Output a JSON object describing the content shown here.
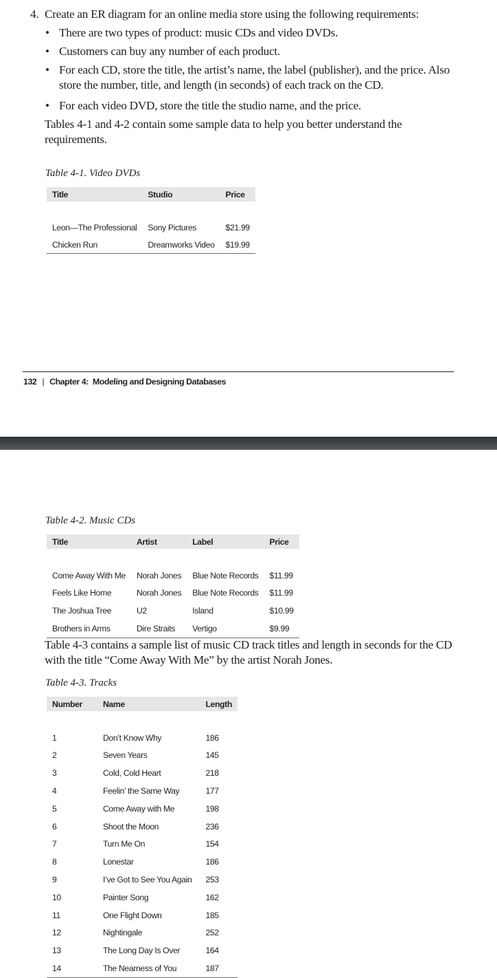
{
  "exercise": {
    "number": "4.",
    "lead": "Create an ER diagram for an online media store using the following requirements:",
    "bullets": [
      "There are two types of product: music CDs and video DVDs.",
      "Customers can buy any number of each product.",
      "For each CD, store the title, the artist’s name, the label (publisher), and the price. Also store the number, title, and length (in seconds) of each track on the CD.",
      "For each video DVD, store the title the studio name, and the price."
    ],
    "after_text": "Tables 4-1 and 4-2 contain some sample data to help you better understand the requirements."
  },
  "table_4_1": {
    "caption": "Table 4-1. Video DVDs",
    "headers": [
      "Title",
      "Studio",
      "Price"
    ],
    "rows": [
      [
        "Leon—The Professional",
        "Sony Pictures",
        "$21.99"
      ],
      [
        "Chicken Run",
        "Dreamworks Video",
        "$19.99"
      ]
    ]
  },
  "footer": {
    "page_number": "132",
    "separator": "|",
    "chapter": "Chapter 4:  Modeling and Designing Databases"
  },
  "table_4_2": {
    "caption": "Table 4-2. Music CDs",
    "headers": [
      "Title",
      "Artist",
      "Label",
      "Price"
    ],
    "rows": [
      [
        "Come Away With Me",
        "Norah Jones",
        "Blue Note Records",
        "$11.99"
      ],
      [
        "Feels Like Home",
        "Norah Jones",
        "Blue Note Records",
        "$11.99"
      ],
      [
        "The Joshua Tree",
        "U2",
        "Island",
        "$10.99"
      ],
      [
        "Brothers in Arms",
        "Dire Straits",
        "Vertigo",
        "$9.99"
      ]
    ]
  },
  "paragraph_4_3": "Table 4-3 contains a sample list of music CD track titles and length in seconds for the CD with the title “Come Away With Me” by the artist Norah Jones.",
  "table_4_3": {
    "caption": "Table 4-3. Tracks",
    "headers": [
      "Number",
      "Name",
      "Length"
    ],
    "rows": [
      [
        "1",
        "Don’t Know Why",
        "186"
      ],
      [
        "2",
        "Seven Years",
        "145"
      ],
      [
        "3",
        "Cold, Cold Heart",
        "218"
      ],
      [
        "4",
        "Feelin’ the Same Way",
        "177"
      ],
      [
        "5",
        "Come Away with Me",
        "198"
      ],
      [
        "6",
        "Shoot the Moon",
        "236"
      ],
      [
        "7",
        "Turn Me On",
        "154"
      ],
      [
        "8",
        "Lonestar",
        "186"
      ],
      [
        "9",
        "I’ve Got to See You Again",
        "253"
      ],
      [
        "10",
        "Painter Song",
        "162"
      ],
      [
        "11",
        "One Flight Down",
        "185"
      ],
      [
        "12",
        "Nightingale",
        "252"
      ],
      [
        "13",
        "The Long Day Is Over",
        "164"
      ],
      [
        "14",
        "The Nearness of You",
        "187"
      ]
    ]
  },
  "colors": {
    "text": "#231f20",
    "table_header_bg": "#e6e6e6",
    "divider_band": "#44484b"
  }
}
